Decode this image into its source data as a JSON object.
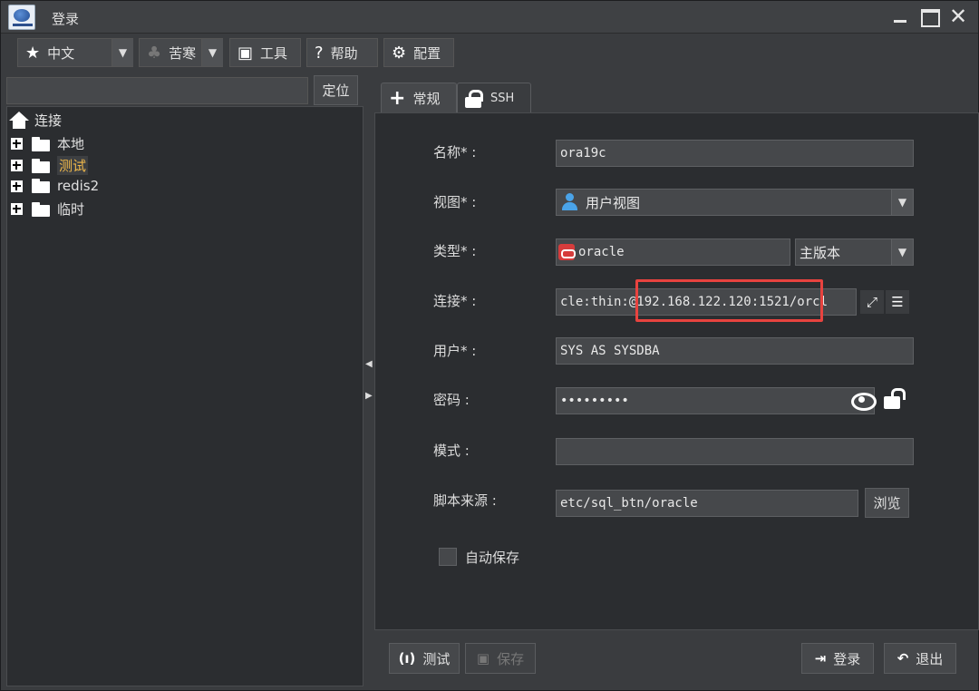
{
  "window": {
    "title": "登录"
  },
  "toolbar": {
    "language": "中文",
    "theme": "苦寒",
    "tools": "工具",
    "help": "帮助",
    "config": "配置"
  },
  "left": {
    "search_value": "",
    "locate_label": "定位",
    "tree_root": "连接",
    "tree_items": [
      "本地",
      "测试",
      "redis2",
      "临时"
    ]
  },
  "tabs": {
    "general": "常规",
    "ssh": "SSH"
  },
  "form": {
    "name_label": "名称* :",
    "name_value": "ora19c",
    "view_label": "视图* :",
    "view_value": "用户视图",
    "type_label": "类型* :",
    "type_value": "oracle",
    "version_value": "主版本",
    "conn_label": "连接* :",
    "conn_value": "cle:thin:@192.168.122.120:1521/orcl",
    "user_label": "用户* :",
    "user_value": "SYS AS SYSDBA",
    "password_label": "密码 :",
    "password_value": "•••••••••",
    "schema_label": "模式 :",
    "schema_value": "",
    "script_label": "脚本来源 :",
    "script_value": "etc/sql_btn/oracle",
    "browse_label": "浏览",
    "autosave_label": "自动保存"
  },
  "bottom": {
    "test_label": "测试",
    "save_label": "保存",
    "login_label": "登录",
    "exit_label": "退出"
  },
  "colors": {
    "highlight": "#e8433f",
    "selected_text": "#f0b84a",
    "user_icon": "#4aa3e8",
    "oracle_icon": "#d63c3c"
  }
}
